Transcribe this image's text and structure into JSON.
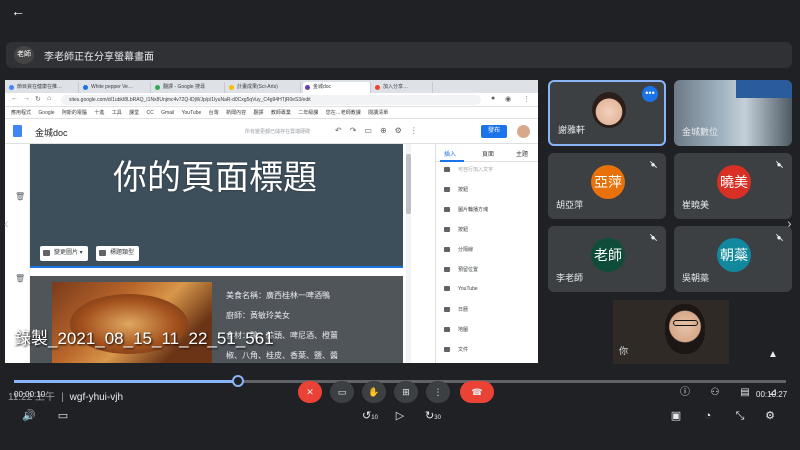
{
  "top": {
    "back_glyph": "←"
  },
  "banner": {
    "avatar_text": "老師",
    "text": "李老師正在分享螢幕畫面"
  },
  "browser": {
    "tabs": [
      "節目資在健康在推…",
      "White pepper Ve…",
      "翻譯 - Google 搜尋",
      "計畫成果(Sci-Arts)",
      "金城doc",
      "加入分享…"
    ],
    "url": "sites.google.com/d/1ubkI8LbRAQ_I1Nx8Unjmc4v72Q-lDjWJp/p/1lyuNaR-d0Cxg5qVuy_C4g94HTjR0eS3/edit",
    "bookmarks": [
      "應用程式",
      "Google",
      "阿斯的電腦",
      "十進",
      "工具",
      "課堂",
      "CC",
      "Gmail",
      "YouTube",
      "台灣",
      "新聞內容",
      "翻譯",
      "教師專業",
      "二年級課",
      "您在…老師教課",
      "閱讀清單"
    ]
  },
  "sites": {
    "title": "金城doc",
    "header_hint": "所有變更都已儲存在雲端硬碟",
    "publish_label": "發布",
    "hero_title": "你的頁面標題",
    "change_image_label": "變更圖片",
    "header_type_label": "標題類型",
    "food_lines": [
      "美食名稱：廣西桂林一啤酒鴨",
      "廚師：黃敏玲美女",
      "食材：鴨、蒜頭、啤尼酒、橙薑",
      "椒、八角、桂皮、香葉、鹽、醬"
    ],
    "panel_tabs": [
      "插入",
      "頁面",
      "主題"
    ],
    "panel_items": [
      "按鈕",
      "圖片輪播方塊",
      "按鈕",
      "分隔線",
      "預留位置",
      "YouTube",
      "日曆",
      "地圖",
      "文件"
    ],
    "panel_top_item": "可自行加入文字"
  },
  "recording_label": "錄製_2021_08_15_11_22_51_561",
  "participants": [
    {
      "name": "謝雅軒",
      "type": "video",
      "speaking": true
    },
    {
      "name": "金城數位",
      "type": "video",
      "speaking": false
    },
    {
      "name": "胡亞萍",
      "avatar_text": "亞萍",
      "avatar_color": "#e8710a",
      "type": "avatar"
    },
    {
      "name": "崔曉美",
      "avatar_text": "曉美",
      "avatar_color": "#d93025",
      "type": "avatar"
    },
    {
      "name": "李老師",
      "avatar_text": "老師",
      "avatar_color": "#0f4c3a",
      "type": "avatar"
    },
    {
      "name": "吳朝蘂",
      "avatar_text": "朝蘂",
      "avatar_color": "#12889e",
      "type": "avatar"
    }
  ],
  "self_view_label": "你",
  "bottom": {
    "time_label": "11:22 上午",
    "meeting_code": "wgf-yhui-vjh",
    "elapsed": "00:00:10",
    "duration": "00:10:27",
    "progress": 0.29,
    "skip_back": "10",
    "skip_forward": "30"
  },
  "colors": {
    "accent": "#8ab4f8",
    "end_call": "#ea4335",
    "publish": "#1a73e8"
  }
}
